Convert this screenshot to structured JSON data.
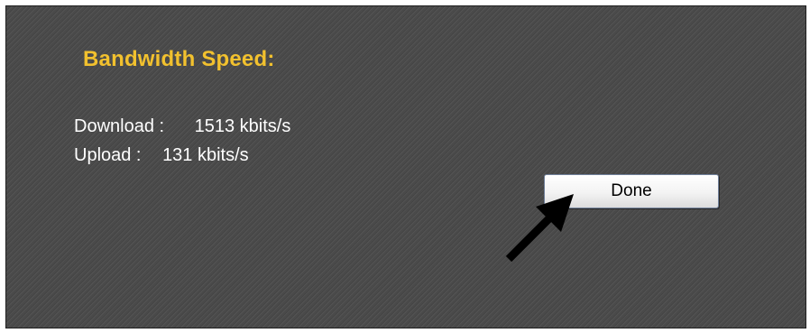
{
  "dialog": {
    "title": "Bandwidth Speed:",
    "download": {
      "label": "Download :",
      "value": "1513 kbits/s"
    },
    "upload": {
      "label": "Upload :",
      "value": "131 kbits/s"
    },
    "done_label": "Done"
  },
  "colors": {
    "title": "#f2c12e",
    "panel_background": "#4a4a4a",
    "text": "#ffffff"
  },
  "icons": {
    "pointer": "arrow-pointer-icon"
  }
}
